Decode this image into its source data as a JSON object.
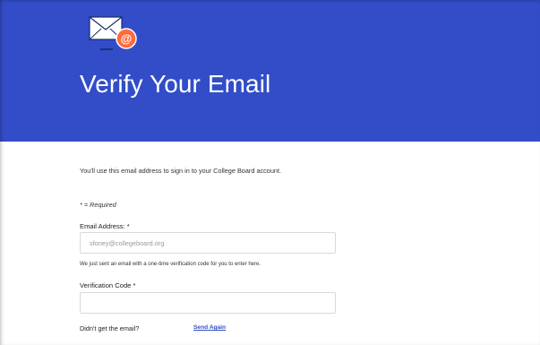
{
  "hero": {
    "title": "Verify Your Email",
    "background_color": "#324dc7",
    "icon": "email-at-icon"
  },
  "form": {
    "intro": "You'll use this email address to sign in to your College Board account.",
    "required_note": "* = Required",
    "email": {
      "label": "Email Address:",
      "required_mark": "*",
      "value": "sfoney@collegeboard.org"
    },
    "hint": "We just sent an email with a one-time verification code for you to enter here.",
    "code": {
      "label": "Verification Code",
      "required_mark": "*",
      "value": ""
    },
    "resend": {
      "prompt": "Didn't get the email?",
      "link_label": "Send Again",
      "link_color": "#324dc7"
    }
  }
}
